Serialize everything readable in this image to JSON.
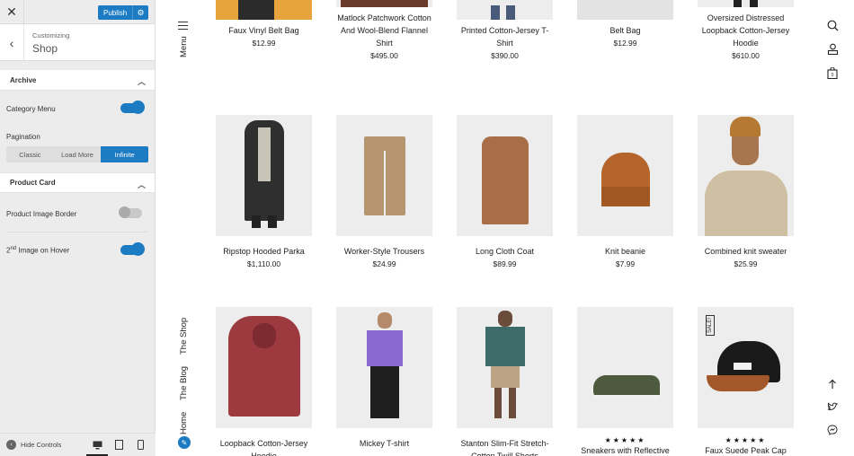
{
  "sidebar": {
    "publish_label": "Publish",
    "breadcrumb": "Customizing",
    "section_title": "Shop",
    "archive": {
      "heading": "Archive",
      "category_menu_label": "Category Menu",
      "category_menu_on": true,
      "pagination_label": "Pagination",
      "pagination_options": [
        "Classic",
        "Load More",
        "Infinite"
      ],
      "pagination_selected": "Infinite"
    },
    "product_card": {
      "heading": "Product Card",
      "image_border_label": "Product Image Border",
      "image_border_on": false,
      "second_image_label_sup": "nd",
      "second_image_label_num": "2",
      "second_image_label_rest": " Image on Hover",
      "second_image_on": true
    },
    "footer": {
      "hide_controls_label": "Hide Controls"
    }
  },
  "preview": {
    "nav": {
      "menu_label": "Menu",
      "links": [
        "The Shop",
        "The Blog",
        "Home"
      ]
    },
    "products_row1": [
      {
        "name": "Faux Vinyl Belt Bag",
        "price": "$12.99"
      },
      {
        "name": "Matlock Patchwork Cotton And Wool-Blend Flannel Shirt",
        "price": "$495.00"
      },
      {
        "name": "Printed Cotton-Jersey T-Shirt",
        "price": "$390.00"
      },
      {
        "name": "Belt Bag",
        "price": "$12.99"
      },
      {
        "name": "Oversized Distressed Loopback Cotton-Jersey Hoodie",
        "price": "$610.00"
      }
    ],
    "products_row2": [
      {
        "name": "Ripstop Hooded Parka",
        "price": "$1,110.00"
      },
      {
        "name": "Worker-Style Trousers",
        "price": "$24.99"
      },
      {
        "name": "Long Cloth Coat",
        "price": "$89.99"
      },
      {
        "name": "Knit beanie",
        "price": "$7.99"
      },
      {
        "name": "Combined knit sweater",
        "price": "$25.99"
      }
    ],
    "products_row3": [
      {
        "name": "Loopback Cotton-Jersey Hoodie",
        "price": ""
      },
      {
        "name": "Mickey T-shirt",
        "price": ""
      },
      {
        "name": "Stanton Slim-Fit Stretch-Cotton Twill Shorts",
        "price": ""
      },
      {
        "name": "Sneakers with Reflective",
        "stars": "★★★★★"
      },
      {
        "name": "Faux Suede Peak Cap",
        "stars": "★★★★★",
        "badge": "SALE!"
      }
    ]
  }
}
